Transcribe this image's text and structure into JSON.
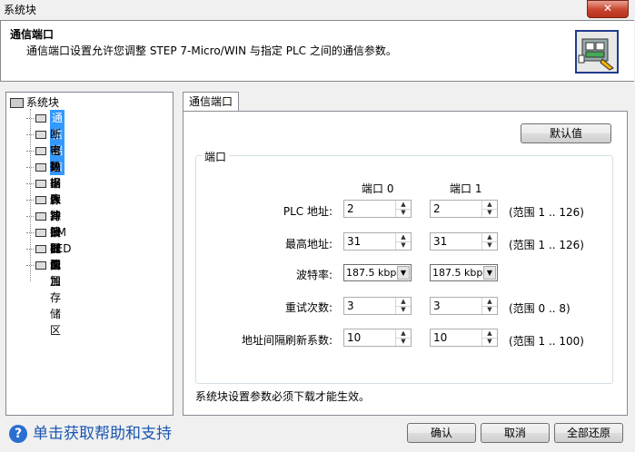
{
  "window": {
    "title": "系统块",
    "close_glyph": "✕"
  },
  "header": {
    "title": "通信端口",
    "description": "通信端口设置允许您调整 STEP 7-Micro/WIN 与指定 PLC 之间的通信参数。",
    "icon": "network-config-icon"
  },
  "tree": {
    "root": "系统块",
    "items": [
      "通信端口",
      "断电数据保持",
      "密码",
      "输出表",
      "输入滤波器",
      "脉冲捕捉位",
      "背景时间",
      "EM 配置",
      "LED 配置",
      "增加存储区"
    ],
    "selected_index": 0
  },
  "tab": {
    "label": "通信端口"
  },
  "defaults_button": "默认值",
  "port_group": {
    "legend": "端口",
    "col0": "端口 0",
    "col1": "端口 1",
    "rows": {
      "plc_addr": {
        "label": "PLC 地址:",
        "port0": "2",
        "port1": "2",
        "range": "(范围 1 .. 126)"
      },
      "max_addr": {
        "label": "最高地址:",
        "port0": "31",
        "port1": "31",
        "range": "(范围 1 .. 126)"
      },
      "baud": {
        "label": "波特率:",
        "port0": "187.5 kbps",
        "port1": "187.5 kbps"
      },
      "retry": {
        "label": "重试次数:",
        "port0": "3",
        "port1": "3",
        "range": "(范围 0 .. 8)"
      },
      "gap": {
        "label": "地址间隔刷新系数:",
        "port0": "10",
        "port1": "10",
        "range": "(范围 1 .. 100)"
      }
    }
  },
  "note": "系统块设置参数必须下载才能生效。",
  "help": {
    "text": "单击获取帮助和支持",
    "glyph": "?"
  },
  "footer": {
    "ok": "确认",
    "cancel": "取消",
    "restore_all": "全部还原"
  }
}
